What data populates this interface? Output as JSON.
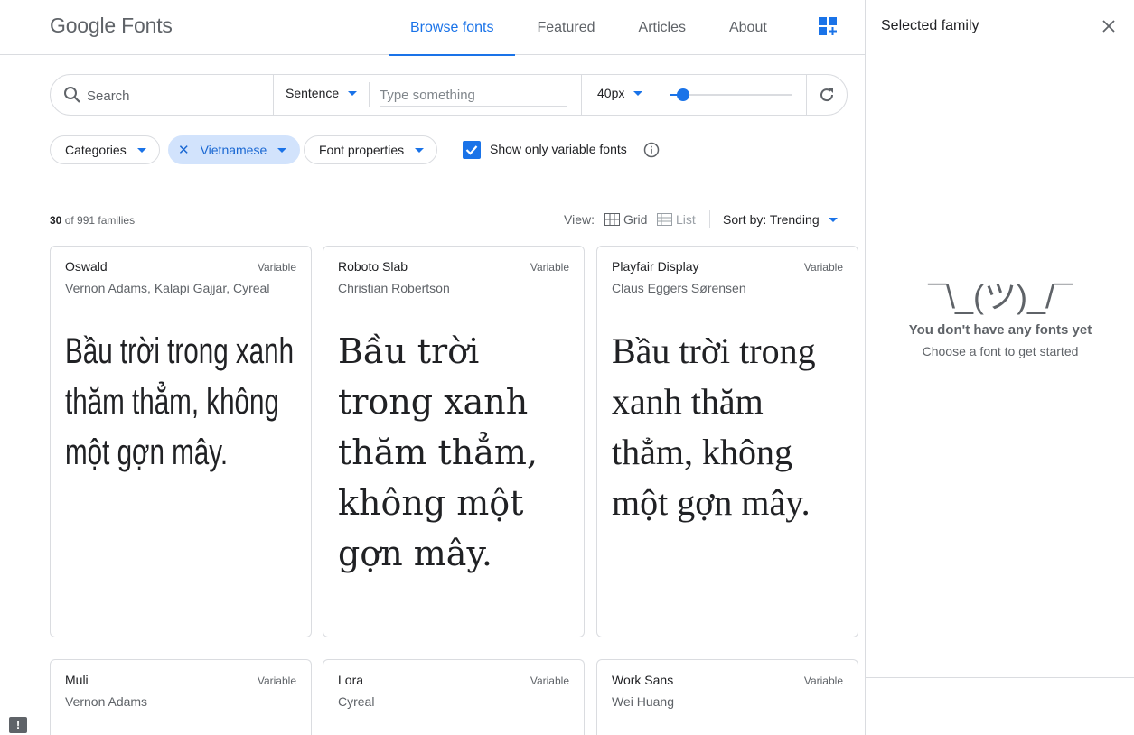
{
  "header": {
    "logo_google": "Google",
    "logo_fonts": "Fonts",
    "tabs": [
      {
        "label": "Browse fonts",
        "active": true
      },
      {
        "label": "Featured"
      },
      {
        "label": "Articles"
      },
      {
        "label": "About"
      }
    ]
  },
  "toolbar": {
    "search_placeholder": "Search",
    "preview_mode": "Sentence",
    "type_placeholder": "Type something",
    "size": "40px",
    "size_slider_fraction": 0.11
  },
  "filters": {
    "categories": "Categories",
    "language": "Vietnamese",
    "properties": "Font properties",
    "variable_checkbox_label": "Show only variable fonts",
    "variable_checked": true
  },
  "results": {
    "shown": "30",
    "total_text": "of 991 families",
    "view_label": "View:",
    "view_grid": "Grid",
    "view_list": "List",
    "sort": "Sort by: Trending"
  },
  "sample_text": "Bầu trời trong xanh thăm thẳm, không một gợn mây.",
  "cards": [
    {
      "name": "Oswald",
      "badge": "Variable",
      "author": "Vernon Adams, Kalapi Gajjar, Cyreal"
    },
    {
      "name": "Roboto Slab",
      "badge": "Variable",
      "author": "Christian Robertson"
    },
    {
      "name": "Playfair Display",
      "badge": "Variable",
      "author": "Claus Eggers Sørensen"
    },
    {
      "name": "Muli",
      "badge": "Variable",
      "author": "Vernon Adams"
    },
    {
      "name": "Lora",
      "badge": "Variable",
      "author": "Cyreal"
    },
    {
      "name": "Work Sans",
      "badge": "Variable",
      "author": "Wei Huang"
    }
  ],
  "panel": {
    "title": "Selected family",
    "shrug": "¯\\_(ツ)_/¯",
    "empty_title": "You don't have any fonts yet",
    "empty_sub": "Choose a font to get started"
  },
  "colors": {
    "accent": "#1a73e8",
    "chip_selected_bg": "#d2e3fc",
    "text_secondary": "#5f6368",
    "border": "#dadce0"
  }
}
